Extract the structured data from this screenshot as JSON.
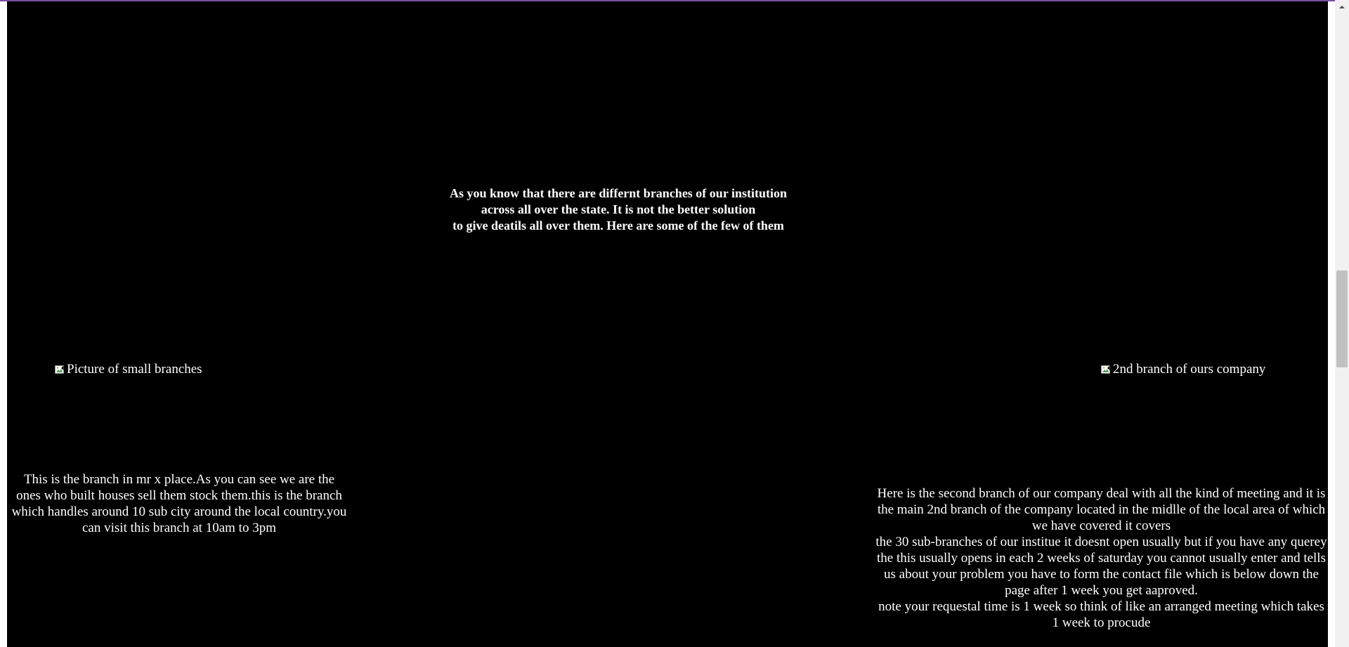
{
  "intro": {
    "lines": [
      "As you know that there are differnt branches of our institution across all over the state. It is not the better solution",
      "to give deatils all over them. Here are some of the few of them"
    ]
  },
  "images": {
    "left_alt": "Picture of small branches",
    "right_alt": "2nd branch of ours company",
    "icon": "broken-image-icon"
  },
  "branch_one": {
    "text": "This is the branch in mr x place.As you can see we are the ones who built houses sell them stock them.this is the branch which handles around 10 sub city around the local country.you can visit this branch at 10am to 3pm"
  },
  "branch_two": {
    "lines": [
      "Here is the second branch of our company deal with all the kind of meeting and it is the main 2nd branch of the company located in the midlle of the local area of which we have covered it covers",
      "the 30 sub-branches of our institue it doesnt open usually but if you have any querey the this usually opens in each 2 weeks of saturday you cannot usually enter and tells us about your problem you have to form the contact file which is below down the page after 1 week you get aaproved.",
      "note your requestal time is 1 week so think of like an arranged meeting which takes 1 week to procude"
    ]
  },
  "colors": {
    "background": "#000000",
    "text": "#ffffff",
    "top_border": "#7b4ea3",
    "scroll_track": "#f1f1f1",
    "scroll_thumb": "#c1c1c1"
  },
  "scrollbar": {
    "icon": "chevron-up-icon"
  }
}
